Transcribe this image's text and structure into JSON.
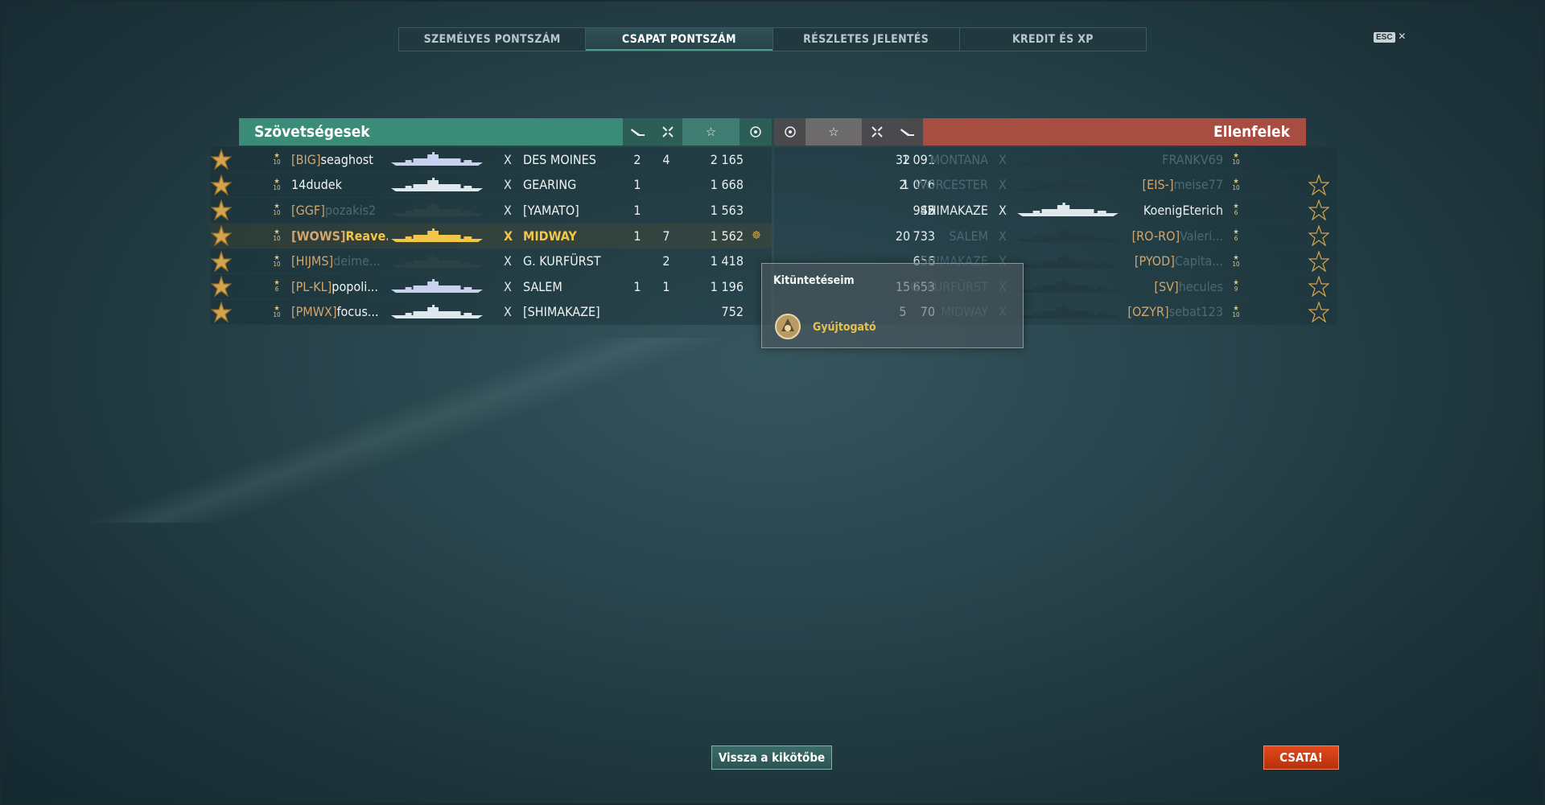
{
  "tabs": [
    {
      "label": "SZEMÉLYES PONTSZÁM",
      "active": false
    },
    {
      "label": "CSAPAT PONTSZÁM",
      "active": true
    },
    {
      "label": "RÉSZLETES JELENTÉS",
      "active": false
    },
    {
      "label": "KREDIT ÉS XP",
      "active": false
    }
  ],
  "esc": {
    "key": "ESC",
    "close": "×"
  },
  "allies": {
    "title": "Szövetségesek",
    "rows": [
      {
        "tier": "10",
        "clan": "[BIG]",
        "name": "seaghost",
        "ship": "DES MOINES",
        "c1": "2",
        "c2": "4",
        "score": "2 165",
        "c4": "",
        "alive": true,
        "me": false,
        "ship_color": "#c9d0f0"
      },
      {
        "tier": "10",
        "clan": "",
        "name": "14dudek",
        "ship": "GEARING",
        "c1": "1",
        "c2": "",
        "score": "1 668",
        "c4": "",
        "alive": true,
        "me": false,
        "ship_color": "#dfe8ec"
      },
      {
        "tier": "10",
        "clan": "[GGF]",
        "name": "pozakis2",
        "ship": "[YAMATO]",
        "c1": "1",
        "c2": "",
        "score": "1 563",
        "c4": "",
        "alive": false,
        "me": false,
        "ship_color": "#2c4146"
      },
      {
        "tier": "10",
        "clan": "[WOWS]",
        "name": "Reave...",
        "ship": "MIDWAY",
        "c1": "1",
        "c2": "7",
        "score": "1 562",
        "c4": "☸",
        "alive": true,
        "me": true,
        "ship_color": "#f2c64a"
      },
      {
        "tier": "10",
        "clan": "[HIJMS]",
        "name": "deime...",
        "ship": "G. KURFÜRST",
        "c1": "",
        "c2": "2",
        "score": "1 418",
        "c4": "",
        "alive": false,
        "me": false,
        "ship_color": "#2c4146"
      },
      {
        "tier": "6",
        "clan": "[PL-KL]",
        "name": "popoli...",
        "ship": "SALEM",
        "c1": "1",
        "c2": "1",
        "score": "1 196",
        "c4": "",
        "alive": true,
        "me": false,
        "ship_color": "#c9d0f0"
      },
      {
        "tier": "10",
        "clan": "[PMWX]",
        "name": "focus...",
        "ship": "[SHIMAKAZE]",
        "c1": "",
        "c2": "",
        "score": "752",
        "c4": "",
        "alive": true,
        "me": false,
        "ship_color": "#dfe8ec"
      }
    ]
  },
  "enemies": {
    "title": "Ellenfelek",
    "rows": [
      {
        "c0": "",
        "score": "1 091",
        "c2": "32",
        "c3": "",
        "ship": "MONTANA",
        "clan": "",
        "name": "FRANKV69",
        "tier": "10",
        "alive": false,
        "medal": false
      },
      {
        "c0": "",
        "score": "1 076",
        "c2": "2",
        "c3": "",
        "ship": "WORCESTER",
        "clan": "[EIS-]",
        "name": "meise77",
        "tier": "10",
        "alive": false,
        "medal": true
      },
      {
        "c0": "",
        "score": "945",
        "c2": "",
        "c3": "2",
        "ship": "SHIMAKAZE",
        "clan": "",
        "name": "KoenigEterich",
        "tier": "6",
        "alive": true,
        "medal": true
      },
      {
        "c0": "",
        "score": "733",
        "c2": "20",
        "c3": "",
        "ship": "SALEM",
        "clan": "[RO-RO]",
        "name": "Valeri...",
        "tier": "6",
        "alive": false,
        "medal": true
      },
      {
        "c0": "",
        "score": "656",
        "c2": "",
        "c3": "",
        "ship": "SHIMAKAZE",
        "clan": "[PYOD]",
        "name": "Capita...",
        "tier": "10",
        "alive": false,
        "medal": true
      },
      {
        "c0": "",
        "score": "653",
        "c2": "15",
        "c3": "",
        "ship": "G. KURFÜRST",
        "clan": "[SV]",
        "name": "hecules",
        "tier": "9",
        "alive": false,
        "medal": true
      },
      {
        "c0": "",
        "score": "70",
        "c2": "5",
        "c3": "",
        "ship": "MIDWAY",
        "clan": "[OZYR]",
        "name": "sebat123",
        "tier": "10",
        "alive": false,
        "medal": true
      }
    ]
  },
  "tooltip": {
    "title": "Kitüntetéseim",
    "item": "Gyújtogató"
  },
  "buttons": {
    "back": "Vissza a kikötőbe",
    "battle": "CSATA!"
  },
  "colors": {
    "ally": "#3a8c78",
    "enemy": "#a84d42",
    "me": "#f2c64a",
    "battle_button": "#d83c14"
  }
}
